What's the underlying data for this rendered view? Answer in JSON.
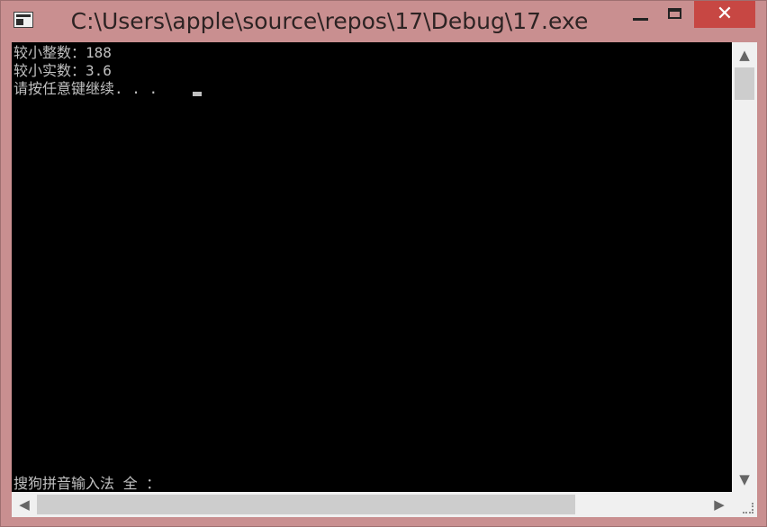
{
  "window": {
    "title": "C:\\Users\\apple\\source\\repos\\17\\Debug\\17.exe",
    "icon": "console-app-icon",
    "controls": {
      "minimize": "minimize-icon",
      "maximize": "maximize-icon",
      "close": "✕"
    }
  },
  "console": {
    "lines": [
      "较小整数：188",
      "较小实数：3.6",
      "请按任意键继续. . ."
    ],
    "ime_status": "搜狗拼音输入法 全 ：",
    "text_color": "#c0c0c0",
    "background": "#000000"
  },
  "scrollbars": {
    "vertical": {
      "up": "▲",
      "down": "▼"
    },
    "horizontal": {
      "left": "◀",
      "right": "▶"
    }
  },
  "colors": {
    "frame": "#c98f90",
    "close_button": "#c74743",
    "scrollbar": "#f0f0f0",
    "scroll_thumb": "#cdcdcd"
  }
}
